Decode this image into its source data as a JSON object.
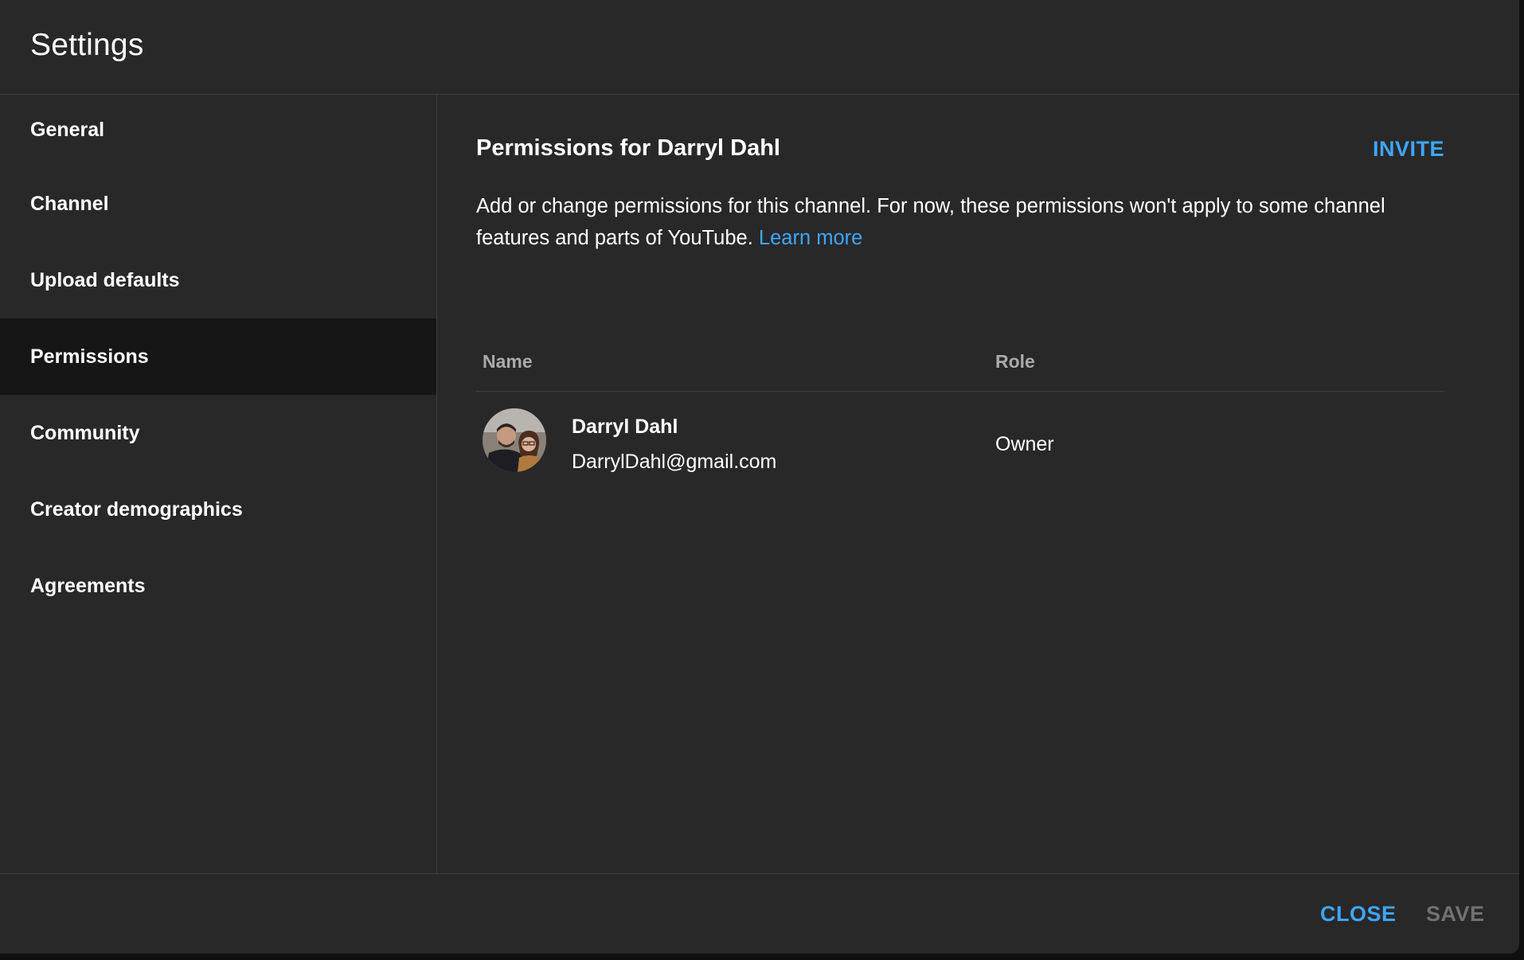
{
  "dialog": {
    "title": "Settings"
  },
  "sidebar": {
    "items": [
      {
        "label": "General"
      },
      {
        "label": "Channel"
      },
      {
        "label": "Upload defaults"
      },
      {
        "label": "Permissions"
      },
      {
        "label": "Community"
      },
      {
        "label": "Creator demographics"
      },
      {
        "label": "Agreements"
      }
    ],
    "active": "Permissions"
  },
  "main": {
    "title": "Permissions for Darryl Dahl",
    "invite_label": "INVITE",
    "description": "Add or change permissions for this channel. For now, these permissions won't apply to some channel features and parts of YouTube.",
    "learn_more": "Learn more",
    "table": {
      "headers": {
        "name": "Name",
        "role": "Role"
      },
      "rows": [
        {
          "name": "Darryl Dahl",
          "email": "DarrylDahl@gmail.com",
          "role": "Owner"
        }
      ]
    }
  },
  "footer": {
    "close_label": "CLOSE",
    "save_label": "SAVE"
  },
  "colors": {
    "accent": "#3ea6ff",
    "background": "#282828",
    "active_nav": "#161616",
    "disabled": "#717171"
  }
}
